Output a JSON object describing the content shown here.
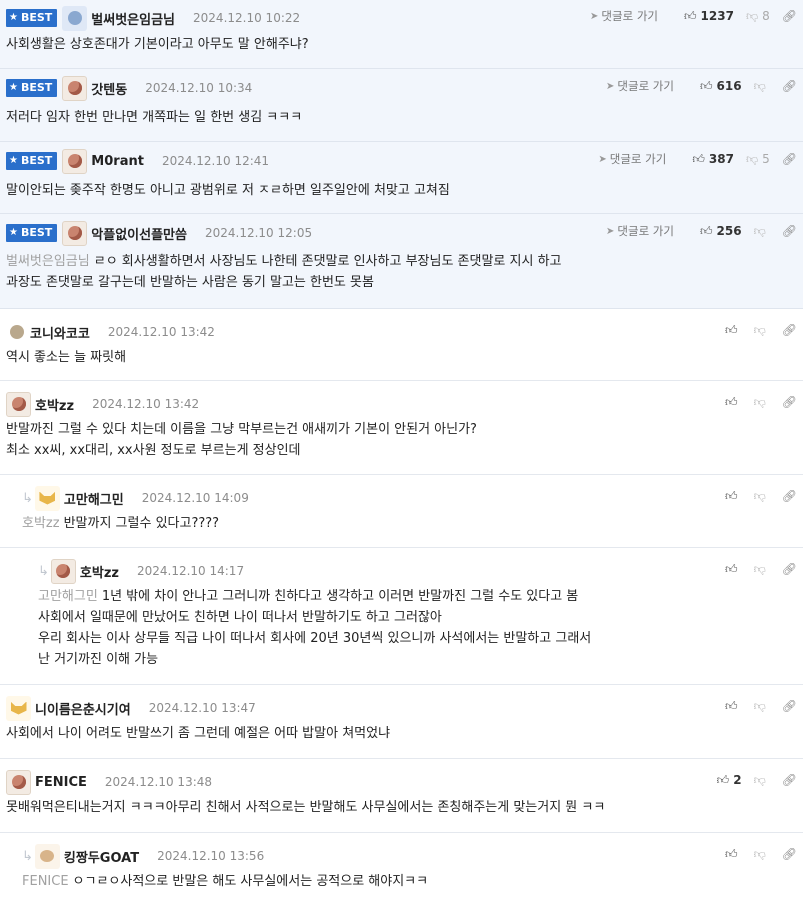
{
  "labels": {
    "best": "BEST",
    "reply": "댓글로 가기"
  },
  "icons": {
    "like": "thumbs-up-icon",
    "dislike": "thumbs-down-icon",
    "share": "share-icon",
    "reply": "reply-arrow-icon",
    "star": "star-icon"
  },
  "colors": {
    "best_badge": "#2a6fcb",
    "best_bg": "#f2f6fc",
    "mention": "#a1a1a1"
  },
  "comments": [
    {
      "best": true,
      "avatar": "blue",
      "nick": "벌써벗은임금님",
      "date": "2024.12.10 10:22",
      "likes": "1237",
      "dislikes": "8",
      "lines": [
        "사회생활은 상호존대가 기본이라고 아무도 말 안해주냐?"
      ]
    },
    {
      "best": true,
      "avatar": "dog",
      "nick": "갓텐동",
      "date": "2024.12.10 10:34",
      "likes": "616",
      "dislikes": "",
      "lines": [
        "저러다 임자 한번 만나면 개쪽파는 일 한번 생김 ㅋㅋㅋ"
      ]
    },
    {
      "best": true,
      "avatar": "dog",
      "nick": "M0rant",
      "date": "2024.12.10 12:41",
      "likes": "387",
      "dislikes": "5",
      "lines": [
        "말이안되는 좆주작 한명도 아니고 광범위로 저 ㅈㄹ하면 일주일안에 처맞고 고쳐짐"
      ]
    },
    {
      "best": true,
      "avatar": "dog",
      "nick": "악플없이선플만씀",
      "date": "2024.12.10 12:05",
      "likes": "256",
      "dislikes": "",
      "mention": "벌써벗은임금님",
      "lines": [
        "ㄹㅇ 회사생활하면서 사장님도 나한테 존댓말로 인사하고 부장님도 존댓말로 지시 하고",
        "과장도 존댓말로 갈구는데 반말하는 사람은 동기 말고는 한번도 못봄"
      ]
    },
    {
      "best": false,
      "avatar": "dot",
      "nick": "코니와코코",
      "date": "2024.12.10 13:42",
      "likes": "",
      "dislikes": "",
      "lines": [
        "역시 좋소는 늘 짜릿해"
      ]
    },
    {
      "best": false,
      "avatar": "dog",
      "nick": "호박zz",
      "date": "2024.12.10 13:42",
      "likes": "",
      "dislikes": "",
      "lines": [
        "반말까진 그럴 수 있다 치는데 이름을 그냥 막부르는건 애새끼가 기본이 안된거 아닌가?",
        "최소 xx씨, xx대리, xx사원 정도로 부르는게 정상인데"
      ]
    },
    {
      "best": false,
      "reply": 1,
      "avatar": "shiba",
      "nick": "고만해그민",
      "date": "2024.12.10 14:09",
      "likes": "",
      "dislikes": "",
      "mention": "호박zz",
      "lines": [
        "반말까지 그럴수 있다고????"
      ]
    },
    {
      "best": false,
      "reply": 2,
      "avatar": "dog",
      "nick": "호박zz",
      "date": "2024.12.10 14:17",
      "likes": "",
      "dislikes": "",
      "mention": "고만해그민",
      "lines": [
        "1년 밖에 차이 안나고 그러니까 친하다고 생각하고 이러면 반말까진 그럴 수도 있다고 봄",
        "사회에서 일때문에 만났어도 친하면 나이 떠나서 반말하기도 하고 그러잖아",
        "우리 회사는 이사 상무들 직급 나이 떠나서 회사에 20년 30년씩 있으니까 사석에서는 반말하고 그래서",
        "난 거기까진 이해 가능"
      ]
    },
    {
      "best": false,
      "avatar": "shiba",
      "nick": "니이름은춘시기여",
      "date": "2024.12.10 13:47",
      "likes": "",
      "dislikes": "",
      "lines": [
        "사회에서 나이 어려도 반말쓰기 좀 그런데 예절은 어따 밥말아 쳐먹었냐"
      ]
    },
    {
      "best": false,
      "avatar": "dog",
      "nick": "FENICE",
      "date": "2024.12.10 13:48",
      "likes": "2",
      "dislikes": "",
      "lines": [
        "못배워먹은티내는거지 ㅋㅋㅋ아무리 친해서 사적으로는 반말해도 사무실에서는 존칭해주는게 맞는거지 뭔 ㅋㅋ"
      ]
    },
    {
      "best": false,
      "reply": 1,
      "avatar": "pup",
      "nick": "킹짱두GOAT",
      "date": "2024.12.10 13:56",
      "likes": "",
      "dislikes": "",
      "mention": "FENICE",
      "lines": [
        "ㅇㄱㄹㅇ사적으로 반말은 해도 사무실에서는 공적으로 해야지ㅋㅋ"
      ]
    }
  ]
}
